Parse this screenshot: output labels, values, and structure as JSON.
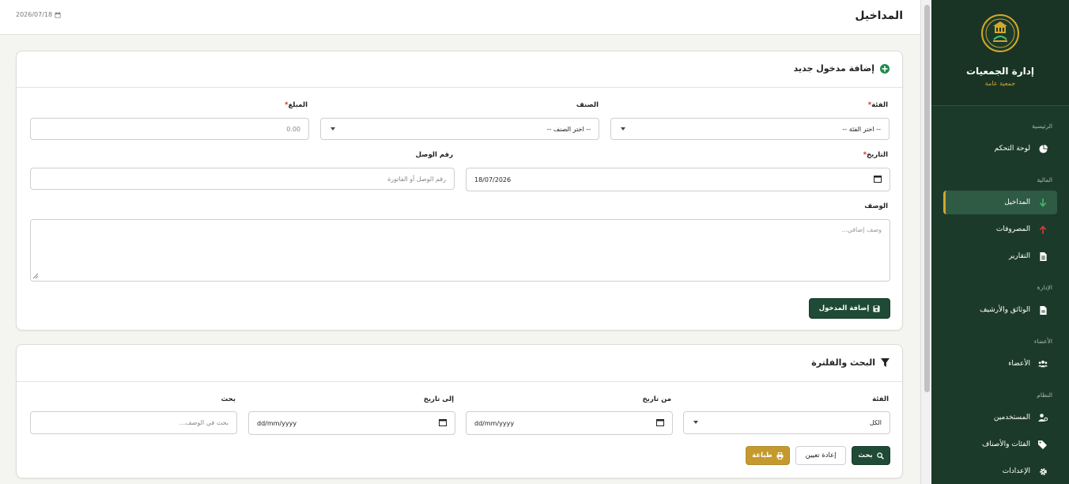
{
  "sidebar": {
    "title": "إدارة الجمعيات",
    "subtitle": "جمعية عامة",
    "sections": {
      "main": "الرئيسية",
      "finance": "المالية",
      "admin": "الإدارة",
      "members": "الأعضاء",
      "system": "النظام"
    },
    "items": {
      "dashboard": "لوحة التحكم",
      "income": "المداخيل",
      "expenses": "المصروفات",
      "reports": "التقارير",
      "documents": "الوثائق والأرشيف",
      "members": "الأعضاء",
      "users": "المستخدمين",
      "categories": "الفئات والأصناف",
      "settings": "الإعدادات"
    }
  },
  "topbar": {
    "title": "المداخيل",
    "date": "2026/07/18"
  },
  "add_form": {
    "title": "إضافة مدخول جديد",
    "category_label": "الفئة",
    "category_placeholder": "-- اختر الفئة --",
    "type_label": "الصنف",
    "type_placeholder": "-- اختر الصنف --",
    "amount_label": "المبلغ",
    "amount_placeholder": "0.00",
    "date_label": "التاريخ",
    "date_value": "18/07/2026",
    "receipt_label": "رقم الوصل",
    "receipt_placeholder": "رقم الوصل أو الفاتورة",
    "desc_label": "الوصف",
    "desc_placeholder": "وصف إضافي...",
    "submit_label": "إضافة المدخول",
    "required_mark": "*"
  },
  "filter": {
    "title": "البحث والفلترة",
    "category_label": "الفئة",
    "category_value": "الكل",
    "from_label": "من تاريخ",
    "from_placeholder": "dd/mm/yyyy",
    "to_label": "إلى تاريخ",
    "to_placeholder": "dd/mm/yyyy",
    "search_label": "بحث",
    "search_placeholder": "بحث في الوصف...",
    "search_button": "بحث",
    "reset_button": "إعادة تعيين",
    "print_button": "طباعة"
  },
  "colors": {
    "sidebar_bg": "#1c3a2a",
    "primary": "#1f4a36",
    "accent_gold": "#d4a72c",
    "income_arrow": "#3fbf6f",
    "expense_arrow": "#e03b3b"
  }
}
